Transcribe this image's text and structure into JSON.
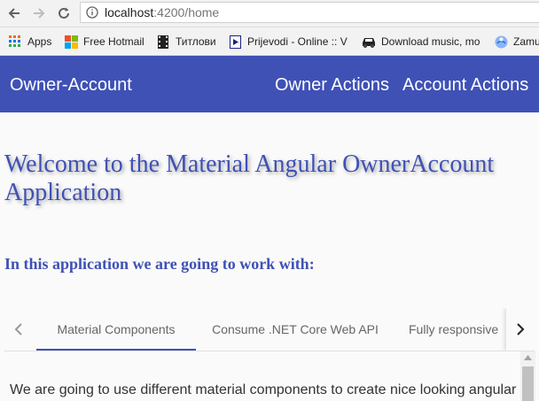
{
  "browser": {
    "url_host": "localhost",
    "url_path": ":4200/home",
    "bookmarks": [
      {
        "label": "Apps",
        "icon": "apps-grid-icon"
      },
      {
        "label": "Free Hotmail",
        "icon": "windows-logo-icon"
      },
      {
        "label": "Титлови",
        "icon": "film-icon"
      },
      {
        "label": "Prijevodi - Online :: V",
        "icon": "play-page-icon"
      },
      {
        "label": "Download music, mo",
        "icon": "car-icon"
      },
      {
        "label": "Zamu",
        "icon": "globe-icon"
      }
    ]
  },
  "toolbar": {
    "brand": "Owner-Account",
    "menu": [
      "Owner Actions",
      "Account Actions"
    ],
    "color": "#3f51b5"
  },
  "content": {
    "welcome_title": "Welcome to the Material Angular OwnerAccount Application",
    "subtitle": "In this application we are going to work with:",
    "tabs": [
      {
        "label": "Material Components",
        "active": true
      },
      {
        "label": "Consume .NET Core Web API",
        "active": false
      },
      {
        "label": "Fully responsive",
        "active": false
      }
    ],
    "tab_body": "We are going to use different material components to create nice looking angular"
  },
  "colors": {
    "primary": "#3f51b5",
    "background": "#fafafa"
  }
}
